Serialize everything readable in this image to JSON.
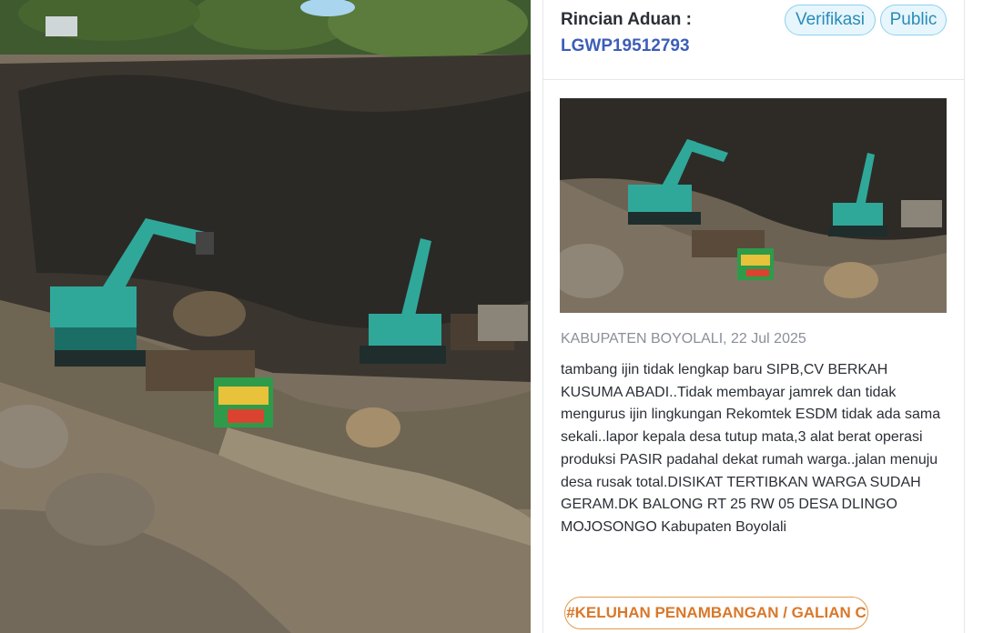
{
  "complaint": {
    "header_label": "Rincian Aduan :",
    "complaint_id": "LGWP19512793",
    "badges": [
      "Verifikasi",
      "Public"
    ],
    "location": "KABUPATEN BOYOLALI",
    "date": "22 Jul 2025",
    "meta_line": "KABUPATEN BOYOLALI, 22 Jul 2025",
    "description": "tambang ijin tidak lengkap baru SIPB,CV BERKAH KUSUMA ABADI..Tidak membayar jamrek dan tidak mengurus ijin lingkungan Rekomtek ESDM tidak ada sama sekali..lapor kepala desa tutup mata,3 alat berat operasi produksi PASIR padahal dekat rumah warga..jalan menuju desa rusak total.DISIKAT TERTIBKAN WARGA SUDAH GERAM.DK BALONG RT 25 RW 05 DESA DLINGO MOJOSONGO Kabupaten Boyolali",
    "category_tag": "#KELUHAN PENAMBANGAN / GALIAN C"
  },
  "colors": {
    "badge_bg": "#e6f6fc",
    "badge_text": "#2a8bb8",
    "id_text": "#3c5db8",
    "tag_text": "#d9782a"
  }
}
